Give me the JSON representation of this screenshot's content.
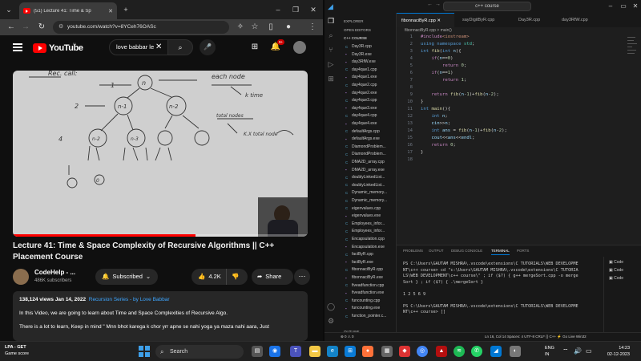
{
  "browser": {
    "tab_title": "(51) Lecture 41: Time & Sp",
    "url": "youtube.com/watch?v=8YCeh76OASc"
  },
  "youtube": {
    "logo_text": "YouTube",
    "region": "IN",
    "search_value": "love babbar le",
    "notifications": "9+",
    "video_progress": 0.62,
    "video_title": "Lecture 41: Time & Space Complexity of Recursive Algorithms || C++ Placement Course",
    "channel_name": "CodeHelp - ...",
    "subscribers": "486K subscribers",
    "subscribed_label": "Subscribed",
    "likes": "4.2K",
    "share_label": "Share",
    "views_date": "138,124 views  Jan 14, 2022",
    "series_link": "Recursion Series - by Love Babbar",
    "desc_line1": "In this Video, we are going to learn about Time and Space Complexities of Recursive Algo.",
    "desc_line2": "There is a lot to learn, Keep in mind \" Mnn bhot karega k chor yrr apne se nahi yoga ya maza nahi aara, Just"
  },
  "whiteboard": {
    "rec_label": "Rec. call:",
    "n": "n",
    "n1": "n-1",
    "n2": "n-2",
    "one": "1",
    "two": "2",
    "four": "4",
    "each_node": "each node",
    "k_time": "k time",
    "total_nodes": "total nodes",
    "ktotal": "K.X total node",
    "zero": "0"
  },
  "vscode": {
    "search": "c++ course",
    "explorer_title": "EXPLORER",
    "open_editors": "OPEN EDITORS",
    "folder": "C++ COURSE",
    "files": [
      "Day3R.cpp",
      "Day3R.exe",
      "day3RfW.exe",
      "day4que1.cpp",
      "day4que1.exe",
      "day4que2.cpp",
      "day4que2.exe",
      "day4que3.cpp",
      "day4que3.exe",
      "day4que4.cpp",
      "day4que4.exe",
      "defaultArgs.cpp",
      "defaultArgs.exe",
      "DiamondProblem...",
      "DiamondProblem...",
      "DMA2D_array.cpp",
      "DMA2D_array.exe",
      "doublyLinkedList...",
      "doublyLinkedList...",
      "Dynamic_memory...",
      "Dynamic_memory...",
      "eigenvalues.cpp",
      "eigenvalues.exe",
      "Employees_infor...",
      "Employees_infor...",
      "Encapsulation.cpp",
      "Encapsulation.exe",
      "factByR.cpp",
      "factByR.exe",
      "fibonnaciByR.cpp",
      "fibonnaciByR.exe",
      "fiveadfunction.cpp",
      "fiveadfunction.exe",
      "funcounting.cpp",
      "funcounting.exe",
      "function_pointer.c..."
    ],
    "outline": "OUTLINE",
    "timeline": "TIMELINE",
    "tabs": [
      "fibonnaciByR.cpp",
      "sayDigitByR.cpp",
      "Day3R.cpp",
      "day3RfW.cpp"
    ],
    "breadcrumb": "fibonnaciByR.cpp > main()",
    "line_numbers": [
      "1",
      "2",
      "3",
      "4",
      "5",
      "6",
      "7",
      "8",
      "9",
      "10",
      "11",
      "12",
      "13",
      "14",
      "15",
      "16",
      "17",
      "18"
    ],
    "panel_tabs": [
      "PROBLEMS",
      "OUTPUT",
      "DEBUG CONSOLE",
      "TERMINAL",
      "PORTS"
    ],
    "terminal": [
      "PS C:\\Users\\GAUTAM MISHRA\\.vscode\\extensions\\C TUTORIALS\\WEB DEVELOPME",
      "NT\\c++ course> cd \"c:\\Users\\GAUTAM MISHRA\\.vscode\\extensions\\C TUTORIA",
      "LS\\WEB DEVELOPMENT\\c++ course\\\" ; if ($?) { g++ mergeSort.cpp -o merge",
      "Sort } ; if ($?) { .\\mergeSort }",
      "",
      "1 2 5 6 9",
      "",
      "PS C:\\Users\\GAUTAM MISHRA\\.vscode\\extensions\\C TUTORIALS\\WEB DEVELOPME",
      "NT\\c++ course> []"
    ],
    "terminal_list": [
      "Code",
      "Code",
      "Code"
    ],
    "status_left": "⊗ 0 ⚠ 0",
    "status_right": "Ln 16, Col 14   Spaces: 4   UTF-8   CRLF   {} C++   ⚡   Go Live   Win32"
  },
  "taskbar": {
    "weather_title": "LPA - GET",
    "weather_sub": "Game score",
    "search": "Search",
    "lang": "ENG",
    "lang2": "IN",
    "time": "14:23",
    "date": "02-12-2023"
  }
}
